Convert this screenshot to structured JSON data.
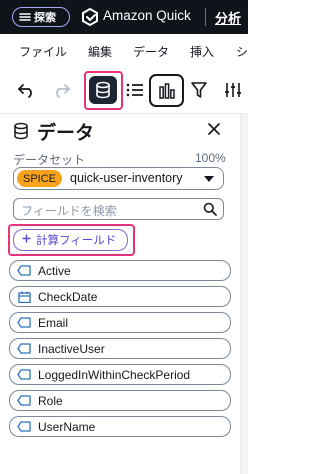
{
  "topbar": {
    "explore_label": "探索",
    "app_name": "Amazon Quick",
    "analysis_link": "分析"
  },
  "menubar": {
    "items": [
      "ファイル",
      "編集",
      "データ",
      "挿入",
      "シ"
    ]
  },
  "toolbar": {
    "icons": [
      "undo-icon",
      "redo-icon",
      "database-icon",
      "list-icon",
      "bar-chart-icon",
      "filter-icon",
      "settings-sliders-icon"
    ]
  },
  "panel": {
    "title": "データ",
    "dataset_label": "データセット",
    "dataset_percent": "100%",
    "spice_badge": "SPICE",
    "dataset_name": "quick-user-inventory",
    "search_placeholder": "フィールドを検索",
    "calc_field_button": "計算フィールド",
    "fields": [
      {
        "name": "Active",
        "type": "dimension"
      },
      {
        "name": "CheckDate",
        "type": "date"
      },
      {
        "name": "Email",
        "type": "dimension"
      },
      {
        "name": "InactiveUser",
        "type": "dimension"
      },
      {
        "name": "LoggedInWithinCheckPeriod",
        "type": "dimension"
      },
      {
        "name": "Role",
        "type": "dimension"
      },
      {
        "name": "UserName",
        "type": "dimension"
      }
    ]
  },
  "colors": {
    "highlight": "#e8327c",
    "spice": "#f9a21c",
    "accent": "#5847d0",
    "topbar_bg": "#0f141a"
  }
}
